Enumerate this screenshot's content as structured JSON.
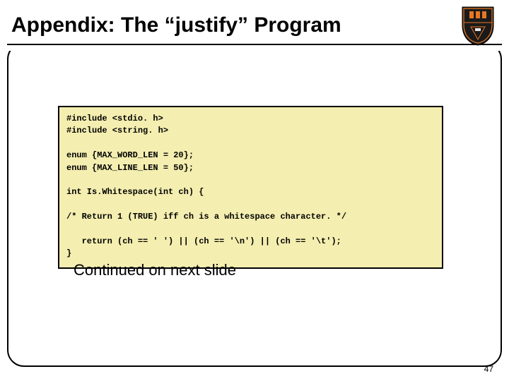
{
  "title": "Appendix: The “justify” Program",
  "code": "#include <stdio. h>\n#include <string. h>\n\nenum {MAX_WORD_LEN = 20};\nenum {MAX_LINE_LEN = 50};\n\nint Is.Whitespace(int ch) {\n\n/* Return 1 (TRUE) iff ch is a whitespace character. */\n\n   return (ch == ' ') || (ch == '\\n') || (ch == '\\t');\n}",
  "continued": "Continued on next slide",
  "page_number": "47"
}
